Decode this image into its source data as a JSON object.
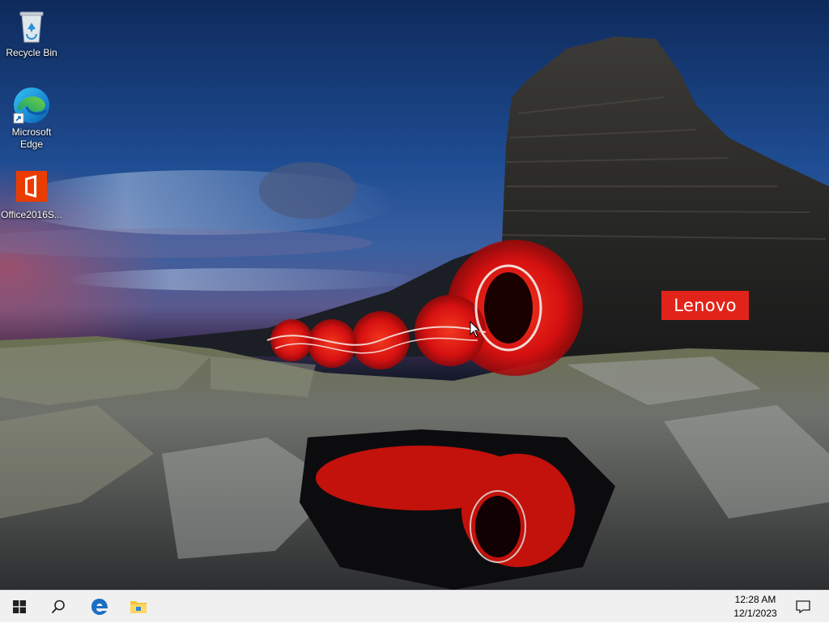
{
  "desktop": {
    "icons": [
      {
        "label": "Recycle Bin",
        "icon": "recycle-bin-icon"
      },
      {
        "label": "Microsoft Edge",
        "icon": "edge-icon"
      },
      {
        "label": "Office2016S...",
        "icon": "office-icon"
      }
    ],
    "wallpaper": {
      "brand_text": "Lenovo",
      "brand_color": "#e2231a",
      "light_trail_color": "#ff1a10"
    }
  },
  "taskbar": {
    "start_icon": "windows-logo-icon",
    "search_icon": "search-icon",
    "pinned": [
      {
        "name": "Microsoft Edge",
        "icon": "edge-icon"
      },
      {
        "name": "File Explorer",
        "icon": "file-explorer-icon"
      }
    ],
    "clock": {
      "time": "12:28 AM",
      "date": "12/1/2023"
    },
    "notification_icon": "action-center-icon",
    "background_color": "#f0f0f0",
    "accent_color": "#0078d7"
  }
}
